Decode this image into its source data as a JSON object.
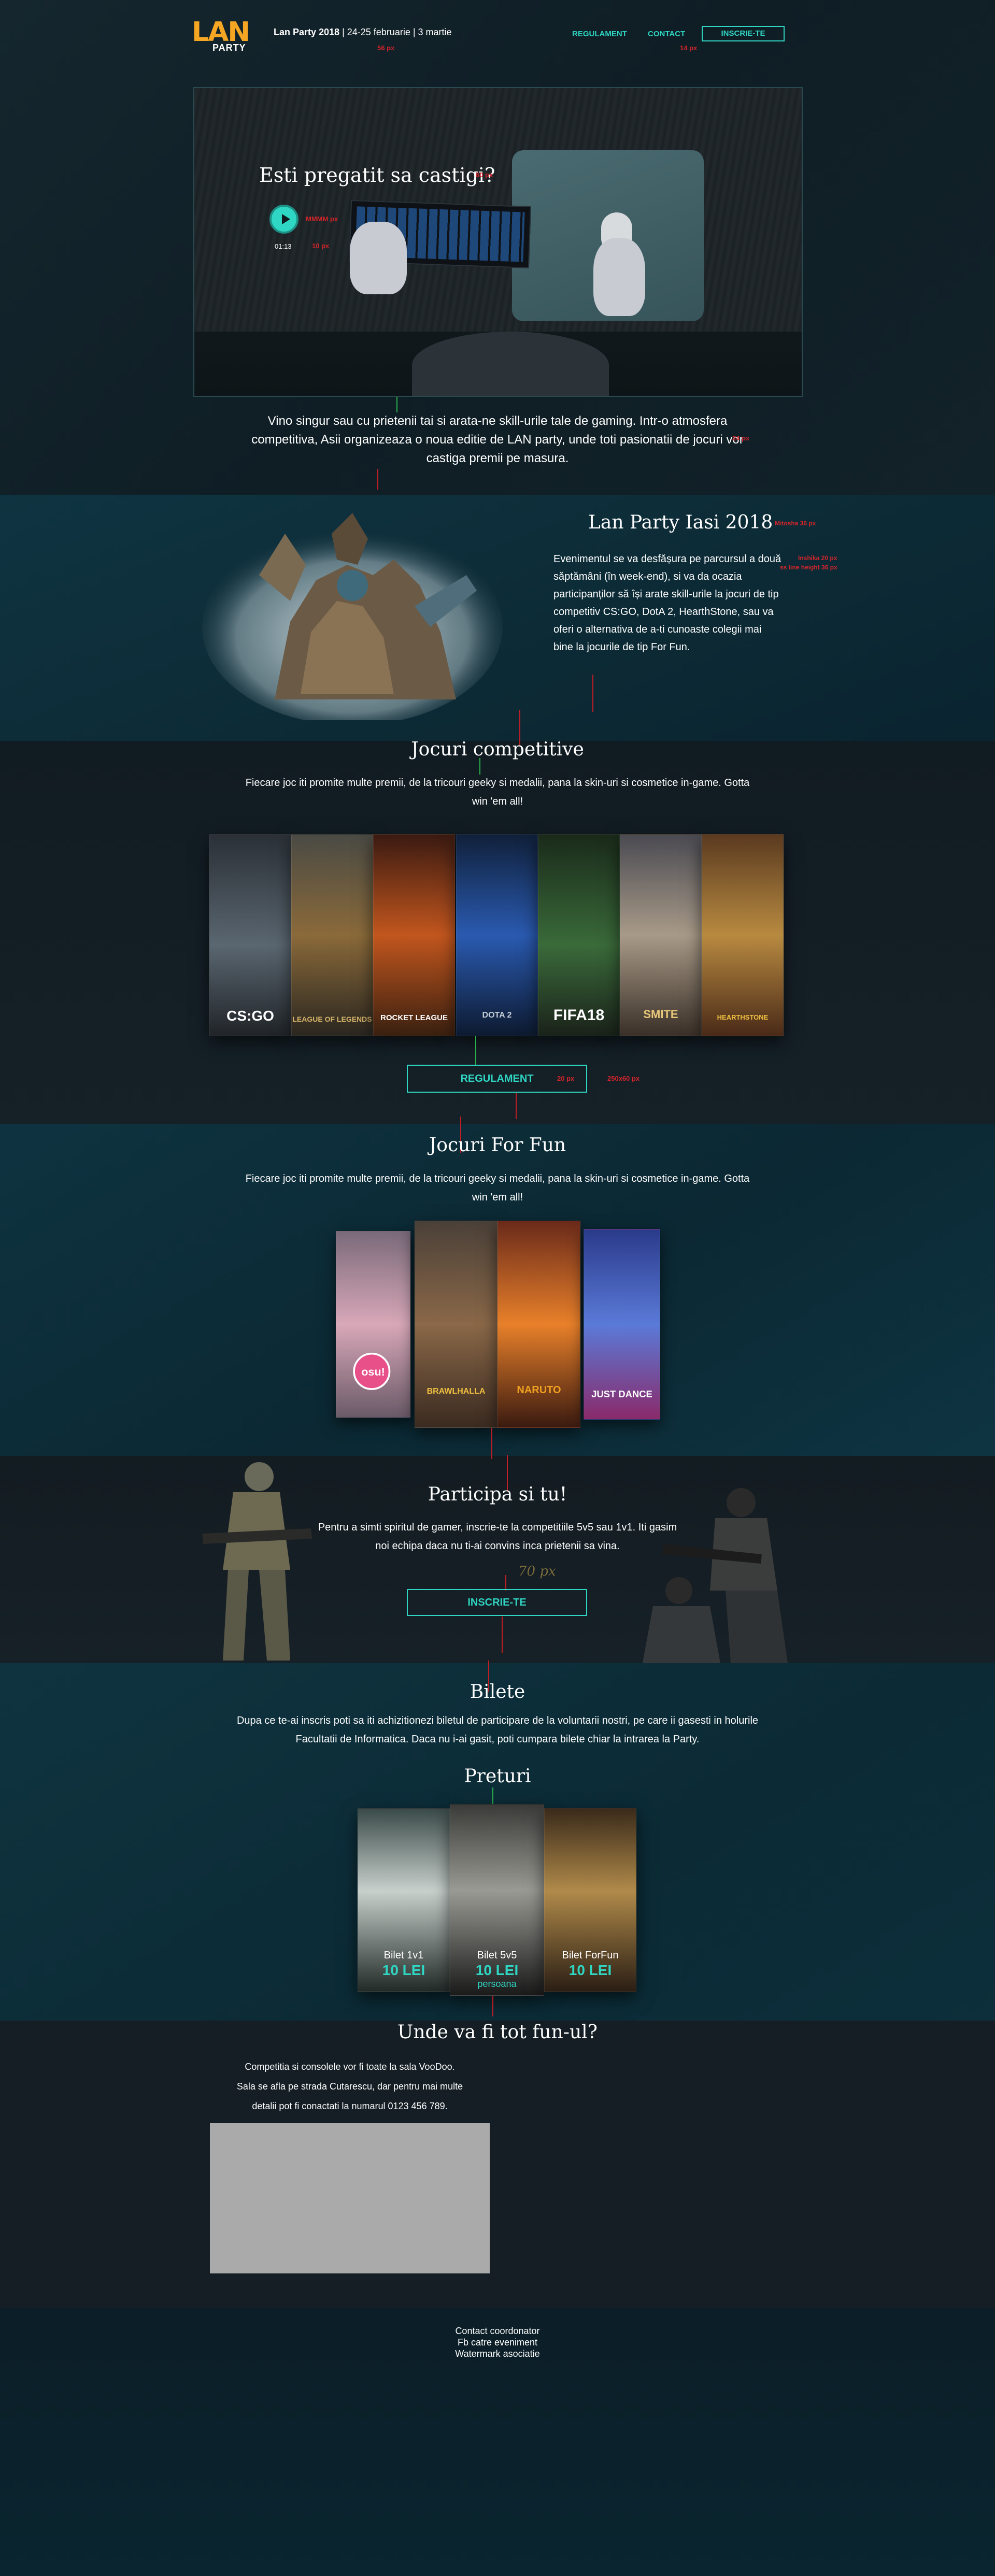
{
  "header": {
    "logo_lan": "LAN",
    "logo_party": "PARTY",
    "event_name": "Lan Party 2018",
    "event_dates": " | 24-25 februarie | 3 martie",
    "nav": [
      "REGULAMENT",
      "CONTACT"
    ],
    "cta": "INSCRIE-TE"
  },
  "hero": {
    "title": "Esti pregatit sa castigi?",
    "video_time": "01:13",
    "description": "Vino singur sau cu prietenii tai si arata-ne skill-urile tale de gaming. Intr-o atmosfera competitiva, Asii organizeaza o noua editie de LAN party, unde toti pasionatii de jocuri vor castiga premii pe masura."
  },
  "about": {
    "title": "Lan Party Iasi 2018",
    "body": "Evenimentul se va desfășura pe parcursul a două săptămâni (în week-end), si va da ocazia participanților să își arate skill-urile la jocuri de tip competitiv CS:GO, DotA 2, HearthStone, sau va oferi o alternativa de a-ti cunoaste colegii mai bine la jocurile de tip For Fun."
  },
  "competitive": {
    "title": "Jocuri competitive",
    "subtitle": "Fiecare joc iti promite multe premii, de la tricouri geeky  si medalii, pana la skin-uri si cosmetice in-game. Gotta win 'em all!",
    "games": [
      "CS:GO",
      "LEAGUE OF LEGENDS",
      "ROCKET LEAGUE",
      "DOTA 2",
      "FIFA18",
      "SMITE",
      "HEARTHSTONE"
    ],
    "button": "REGULAMENT"
  },
  "fun": {
    "title": "Jocuri For Fun",
    "subtitle": "Fiecare joc iti promite multe premii, de la tricouri geeky  si medalii, pana la skin-uri si cosmetice in-game. Gotta win 'em all!",
    "games": [
      "osu!",
      "BRAWLHALLA",
      "NARUTO",
      "JUST DANCE"
    ]
  },
  "participate": {
    "title": "Participa si tu!",
    "subtitle": "Pentru a simti spiritul de gamer, inscrie-te la competitiile 5v5 sau 1v1. Iti gasim noi echipa daca nu ti-ai convins inca prietenii sa vina.",
    "button": "INSCRIE-TE",
    "handwritten": "70 px"
  },
  "tickets": {
    "title": "Bilete",
    "subtitle": "Dupa ce te-ai inscris poti sa iti achizitionezi biletul de participare de la voluntarii nostri, pe care ii gasesti in holurile Facultatii de Informatica. Daca nu i-ai gasit, poti cumpara bilete chiar la intrarea la Party.",
    "prices_title": "Preturi",
    "items": [
      {
        "name": "Bilet 1v1",
        "price": "10 LEI",
        "note": ""
      },
      {
        "name": "Bilet 5v5",
        "price": "10 LEI",
        "note": "persoana"
      },
      {
        "name": "Bilet ForFun",
        "price": "10 LEI",
        "note": ""
      }
    ]
  },
  "location": {
    "title": "Unde va fi tot fun-ul?",
    "lines": [
      "Competitia si consolele vor fi toate la sala VooDoo.",
      "Sala se afla pe strada Cutarescu, dar pentru mai multe",
      "detalii pot fi conactati la numarul 0123 456 789."
    ]
  },
  "footer": {
    "lines": [
      "Contact coordonator",
      "Fb catre eveniment",
      "Watermark asociatie"
    ]
  },
  "annotations": {
    "a1": "56 px",
    "a2": "14 px",
    "a3": "60 px",
    "a4": "MMMM px",
    "a5": "10 px",
    "a6": "24 px",
    "a7": "Mitosha 36 px",
    "a8": "Inshika 20 px",
    "a9": "ss line height 36 px",
    "a10": "20 px",
    "a11": "250x60 px"
  },
  "colors": {
    "accent": "#2fd6c3",
    "logo": "#f5a623",
    "annotation": "#d2242a"
  }
}
